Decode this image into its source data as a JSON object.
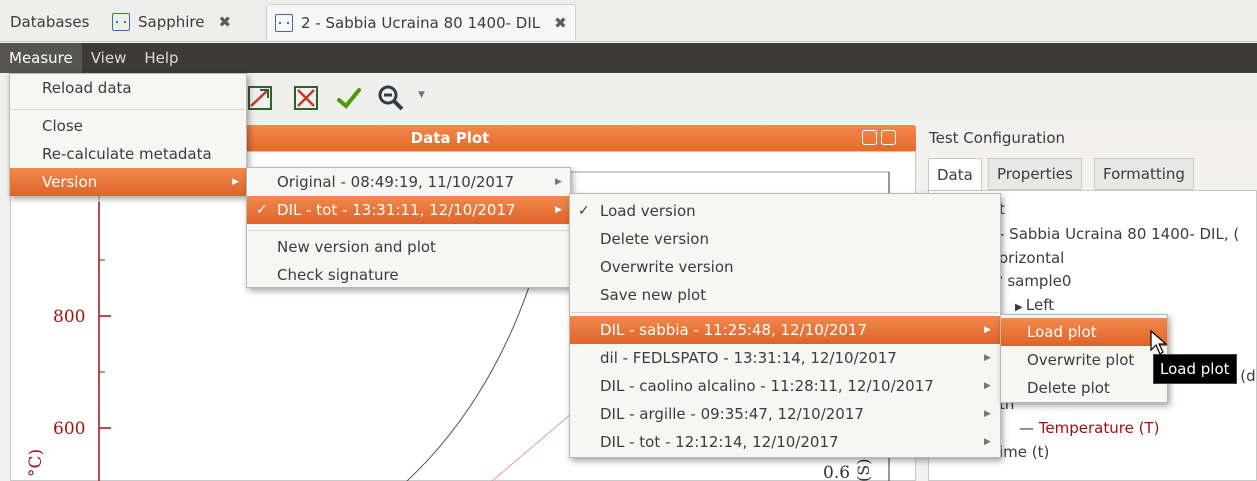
{
  "tabs": [
    {
      "label": "Databases"
    },
    {
      "label": "Sapphire"
    },
    {
      "label": "2 - Sabbia Ucraina 80 1400- DIL"
    }
  ],
  "menubar": {
    "items": [
      "Measure",
      "View",
      "Help"
    ]
  },
  "measure_menu": {
    "reload": "Reload data",
    "close": "Close",
    "recalc": "Re-calculate metadata",
    "version": "Version"
  },
  "version_menu": {
    "original": "Original - 08:49:19, 11/10/2017",
    "current": "DIL - tot - 13:31:11, 12/10/2017",
    "new_version": "New version and plot",
    "check_signature": "Check signature"
  },
  "version_actions_menu": {
    "load": "Load version",
    "delete": "Delete version",
    "overwrite": "Overwrite version",
    "save_plot": "Save new plot",
    "plots": [
      "DIL - sabbia - 11:25:48, 12/10/2017",
      "dil - FEDLSPATO - 13:31:14, 12/10/2017",
      "DIL - caolino alcalino - 11:28:11, 12/10/2017",
      "DIL - argille - 09:35:47, 12/10/2017",
      "DIL - tot - 12:12:14, 12/10/2017"
    ]
  },
  "plot_menu": {
    "load": "Load plot",
    "overwrite": "Overwrite plot",
    "delete": "Delete plot"
  },
  "tooltip": "Load plot",
  "plot_dock": {
    "title": "Data Plot",
    "y_ticks": [
      "800",
      "600"
    ],
    "y_axis_fragment": "°C)",
    "right_axis_fragment": "0.6",
    "right_axis_unit_fragment": "(S)"
  },
  "right_panel": {
    "title": "Test Configuration",
    "tabs": [
      "Data",
      "Properties",
      "Formatting"
    ],
    "tree": {
      "root_fragment": "t",
      "measure_fragment": "- Sabbia Ucraina 80 1400- DIL, (",
      "horizontal_fragment": "orizontal",
      "sample": "sample0",
      "left": "Left",
      "displacement_fragment": "ement (d)",
      "th_fragment": "th",
      "temperature": "Temperature (T)",
      "time_fragment": "ime (t)"
    }
  },
  "colors": {
    "accent": "#e8692a",
    "menubar": "#3c3b37",
    "curve_red": "#a01010"
  }
}
